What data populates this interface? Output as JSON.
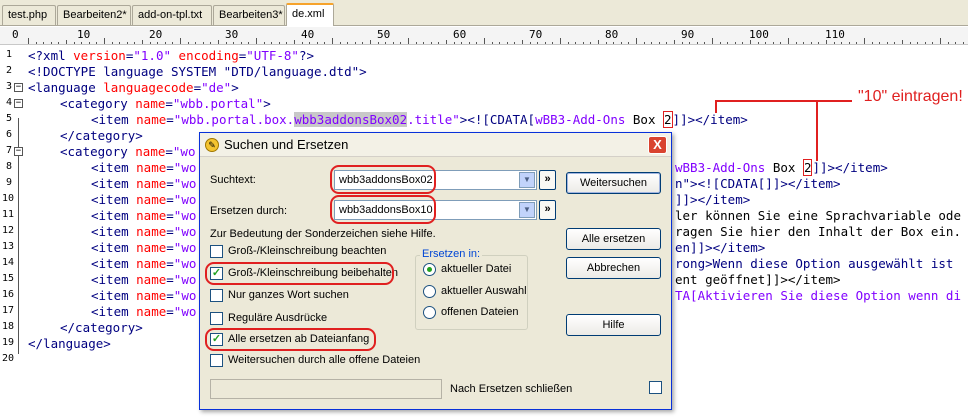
{
  "tabs": [
    "test.php",
    "Bearbeiten2*",
    "add-on-tpl.txt",
    "Bearbeiten3*",
    "de.xml"
  ],
  "active_tab": "de.xml",
  "ruler_labels": [
    "0",
    "10",
    "20",
    "30",
    "40",
    "50",
    "60",
    "70",
    "80",
    "90",
    "100",
    "110"
  ],
  "line_numbers": [
    "1",
    "2",
    "3",
    "4",
    "5",
    "6",
    "7",
    "8",
    "9",
    "10",
    "11",
    "12",
    "13",
    "14",
    "15",
    "16",
    "17",
    "18",
    "19",
    "20"
  ],
  "code": {
    "l1": {
      "a": "<?xml ",
      "b": "version",
      "c": "=",
      "d": "\"1.0\"",
      "e": " encoding",
      "f": "=",
      "g": "\"UTF-8\"",
      "h": "?>"
    },
    "l2": "<!DOCTYPE language SYSTEM \"DTD/language.dtd\">",
    "l3": {
      "a": "<language ",
      "b": "languagecode",
      "c": "=",
      "d": "\"de\"",
      "e": ">"
    },
    "l4": {
      "a": "<category ",
      "b": "name",
      "c": "=",
      "d": "\"wbb.portal\"",
      "e": ">"
    },
    "l5": {
      "a": "<item ",
      "b": "name",
      "c": "=",
      "d1": "\"wbb.portal.box.",
      "d2": "wbb3addonsBox02",
      "d3": ".title\"",
      "e": "><![CDATA[",
      "f": "wBB3-Add-Ons",
      "g": " Box ",
      "h": "2",
      "i": "]]></item>"
    },
    "l6": "</category>",
    "l7": {
      "a": "<category ",
      "b": "name",
      "c": "=",
      "d": "\"wo"
    },
    "l8": {
      "a": "<item ",
      "b": "name",
      "c": "=",
      "d": "\"wo",
      "r1": "wBB3-Add-Ons",
      "r2": " Box ",
      "r3": "2",
      "r4": "]]></item>"
    },
    "l9": {
      "a": "<item ",
      "b": "name",
      "c": "=",
      "d": "\"wo",
      "r": "n\"><![CDATA[]]></item>"
    },
    "l10": {
      "a": "<item ",
      "b": "name",
      "c": "=",
      "d": "\"wo",
      "r": "]]></item>"
    },
    "l11": {
      "a": "<item ",
      "b": "name",
      "c": "=",
      "d": "\"wo",
      "r": "ler können Sie eine Sprachvariable ode"
    },
    "l12": {
      "a": "<item ",
      "b": "name",
      "c": "=",
      "d": "\"wo",
      "r": "ragen Sie hier den Inhalt der Box ein."
    },
    "l13": {
      "a": "<item ",
      "b": "name",
      "c": "=",
      "d": "\"wo",
      "r": "en]]></item>"
    },
    "l14": {
      "a": "<item ",
      "b": "name",
      "c": "=",
      "d": "\"wo",
      "r": "rong>Wenn diese Option ausgewählt ist"
    },
    "l15": {
      "a": "<item ",
      "b": "name",
      "c": "=",
      "d": "\"wo",
      "r": "ent geöffnet]]></item>"
    },
    "l16": {
      "a": "<item ",
      "b": "name",
      "c": "=",
      "d": "\"wo",
      "r": "TA[Aktivieren Sie diese Option wenn di"
    },
    "l17": "</category>",
    "l18": "</language>"
  },
  "annotation": "\"10\" eintragen!",
  "dialog": {
    "title": "Suchen und Ersetzen",
    "close": "X",
    "suchtext_label": "Suchtext:",
    "suchtext_value": "wbb3addonsBox02",
    "ersetzen_label": "Ersetzen durch:",
    "ersetzen_value": "wbb3addonsBox10",
    "hint": "Zur Bedeutung der Sonderzeichen siehe Hilfe.",
    "arrow": "»",
    "options": [
      {
        "label": "Groß-/Kleinschreibung beachten",
        "checked": false
      },
      {
        "label": "Groß-/Kleinschreibung beibehalten",
        "checked": true
      },
      {
        "label": "Nur ganzes Wort suchen",
        "checked": false
      },
      {
        "label": "Reguläre Ausdrücke",
        "checked": false
      },
      {
        "label": "Alle ersetzen ab Dateianfang",
        "checked": true
      },
      {
        "label": "Weitersuchen durch alle offene Dateien",
        "checked": false
      }
    ],
    "group_title": "Ersetzen in:",
    "radios": [
      {
        "label": "aktueller Datei",
        "selected": true
      },
      {
        "label": "aktueller Auswahl",
        "selected": false
      },
      {
        "label": "offenen Dateien",
        "selected": false
      }
    ],
    "buttons": {
      "weiter": "Weitersuchen",
      "alle": "Alle ersetzen",
      "abbrechen": "Abbrechen",
      "hilfe": "Hilfe"
    },
    "close_after_label": "Nach Ersetzen schließen",
    "close_after_checked": false
  },
  "colors": {
    "tag": "#000080",
    "attr": "#ff0000",
    "value": "#8000ff",
    "annotation": "#e02020"
  }
}
